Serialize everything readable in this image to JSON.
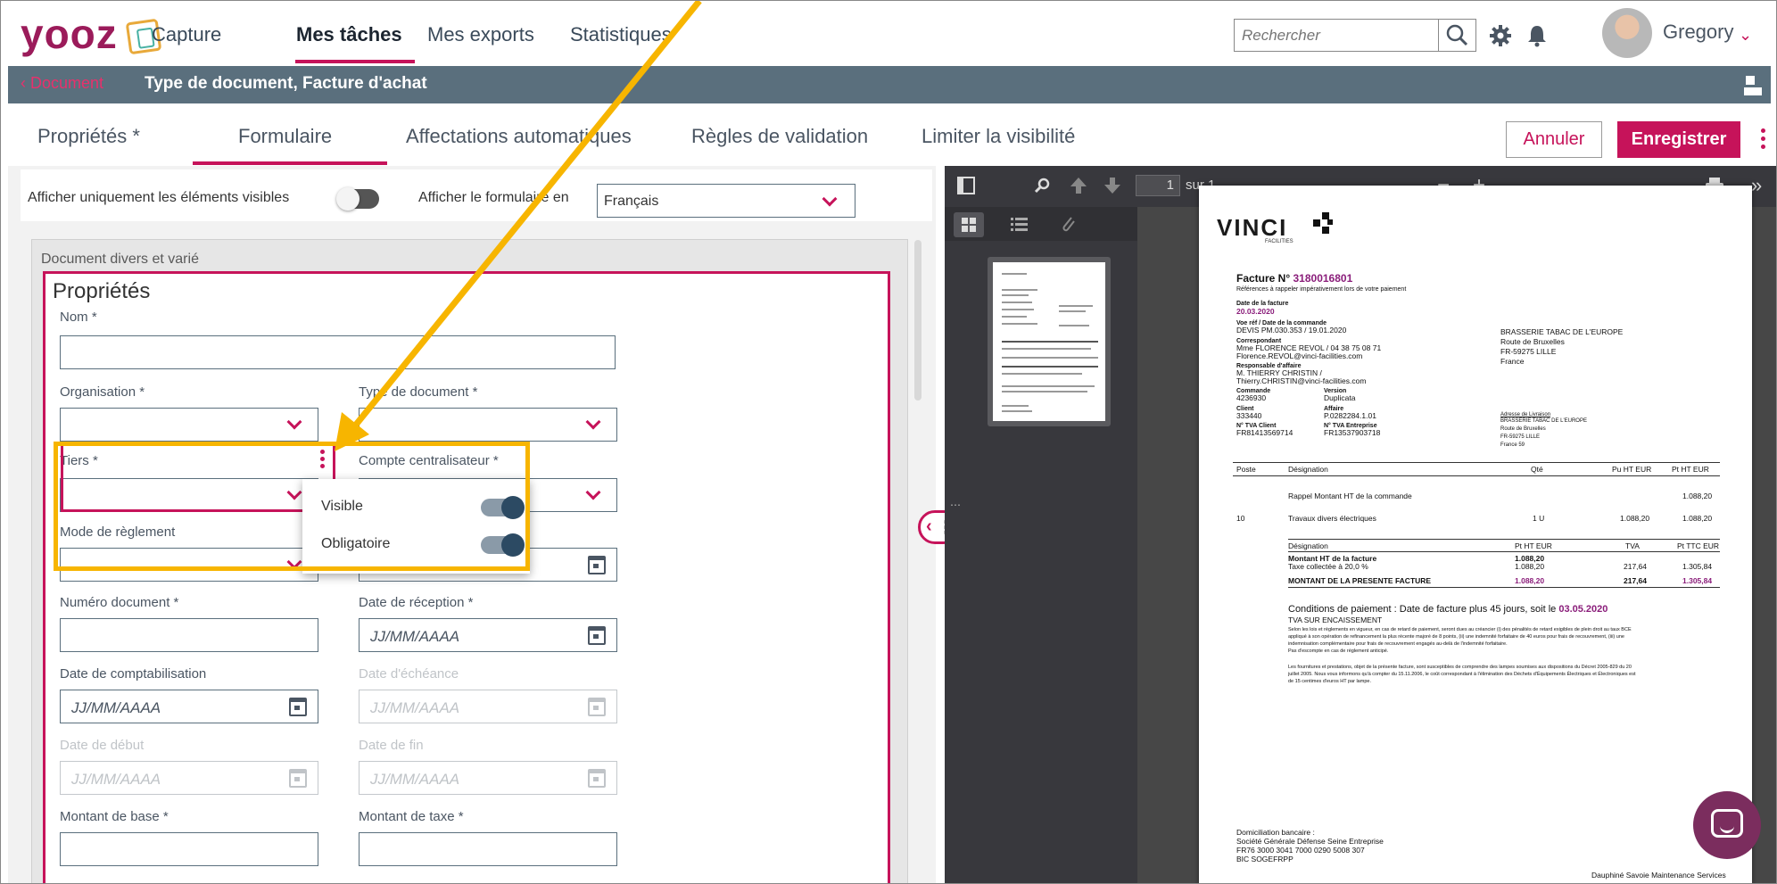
{
  "topnav": {
    "logo": "yooz",
    "links": [
      "Capture",
      "Mes tâches",
      "Mes exports",
      "Statistiques"
    ],
    "search_placeholder": "Rechercher",
    "user": "Gregory"
  },
  "breadcrumb": {
    "back": "Document",
    "title": "Type de document, Facture d'achat"
  },
  "subtabs": [
    "Propriétés *",
    "Formulaire",
    "Affectations automatiques",
    "Règles de validation",
    "Limiter la visibilité"
  ],
  "actions": {
    "cancel": "Annuler",
    "save": "Enregistrer"
  },
  "options": {
    "visible_only": "Afficher uniquement les éléments visibles",
    "show_form_in": "Afficher le formulaire en",
    "language": "Français"
  },
  "form": {
    "section": "Document divers et varié",
    "title": "Propriétés",
    "date_placeholder": "JJ/MM/AAAA",
    "fields": {
      "nom": "Nom *",
      "organisation": "Organisation *",
      "type_document": "Type de document *",
      "tiers": "Tiers *",
      "compte": "Compte centralisateur *",
      "mode_reglement": "Mode de règlement",
      "numero": "Numéro document *",
      "date_reception": "Date de réception *",
      "date_compta": "Date de comptabilisation",
      "date_echeance": "Date d'échéance",
      "date_debut": "Date de début",
      "date_fin": "Date de fin",
      "montant_base": "Montant de base *",
      "montant_taxe": "Montant de taxe *"
    }
  },
  "context_menu": {
    "visible": "Visible",
    "obligatoire": "Obligatoire"
  },
  "viewer": {
    "page": "1",
    "page_of": "sur 1",
    "pdf": {
      "logo": "VINCI",
      "logo_sub": "FACILITIES",
      "invoice_label": "Facture N°",
      "invoice_no": "3180016801",
      "ref_note": "Références à rappeler impérativement lors de votre paiement",
      "date_label": "Date de la facture",
      "date": "20.03.2020",
      "order_label": "Voe réf / Date de la commande",
      "order": "DEVIS PM.030.353 / 19.01.2020",
      "corr_label": "Correspondant",
      "corr1": "Mme FLORENCE REVOL / 04 38 75 08 71",
      "corr2": "Florence.REVOL@vinci-facilities.com",
      "resp_label": "Responsable d'affaire",
      "resp1": "M. THIERRY CHRISTIN /",
      "resp2": "Thierry.CHRISTIN@vinci-facilities.com",
      "cmd_label": "Commande",
      "cmd": "4236930",
      "version_label": "Version",
      "version": "Duplicata",
      "client_label": "Client",
      "client": "333440",
      "affaire_label": "Affaire",
      "affaire": "P.0282284.1.01",
      "tva_client_label": "N° TVA Client",
      "tva_client": "FR81413569714",
      "tva_ent_label": "N° TVA Entreprise",
      "tva_ent": "FR13537903718",
      "addr1": "BRASSERIE TABAC DE L'EUROPE",
      "addr2": "Route de Bruxelles",
      "addr3": "FR-59275 LILLE",
      "addr4": "France",
      "deliv_label": "Adresse de Livraison",
      "deliv1": "BRASSERIE TABAC DE L'EUROPE",
      "deliv2": "Route de Bruxelles",
      "deliv3": "FR-59275 LILLE",
      "deliv4": "France 59",
      "col_poste": "Poste",
      "col_designation": "Désignation",
      "col_qte": "Qté",
      "col_pu": "Pu HT EUR",
      "col_pt": "Pt HT EUR",
      "row_rappel": "Rappel Montant HT de la commande",
      "row_rappel_val": "1.088,20",
      "row_poste": "10",
      "row_travaux": "Travaux divers électriques",
      "row_qte": "1 U",
      "row_pu": "1.088,20",
      "row_pt": "1.088,20",
      "tot_col_des": "Désignation",
      "tot_col_ht": "Pt HT EUR",
      "tot_col_tva": "TVA",
      "tot_col_ttc": "Pt TTC EUR",
      "tot_ht_label": "Montant HT de la facture",
      "tot_ht": "1.088,20",
      "tot_tax_label": "Taxe collectée à 20,0 %",
      "tot_tax_base": "1.088,20",
      "tot_tax_tva": "217,64",
      "tot_tax_ttc": "1.305,84",
      "tot_final_label": "MONTANT DE LA PRESENTE FACTURE",
      "tot_final_ht": "1.088,20",
      "tot_final_tva": "217,64",
      "tot_final_ttc": "1.305,84",
      "cond_label": "Conditions de paiement :",
      "cond_text": "Date de facture plus 45 jours,",
      "cond_due": "soit le",
      "cond_date": "03.05.2020",
      "tva_enc": "TVA SUR ENCAISSEMENT",
      "legal1": "Selon les lois et règlements en vigueur, en cas de retard de paiement, seront dues au créancier (i) des pénalités de retard exigibles de plein droit au taux BCE",
      "legal2": "appliqué à son opération de refinancement la plus récente majoré de 8 points, (ii) une indemnité forfaitaire de 40 euros pour frais de recouvrement, (iii) une",
      "legal3": "indemnisation complémentaire pour frais de recouvrement engagés au-delà de l'indemnité forfaitaire.",
      "legal4": "Pas d'escompte en cas de règlement anticipé.",
      "legal5": "Les fournitures et prestations, objet de la présente facture, sont susceptibles de comprendre des lampes soumises aux dispositions du Décret 2005-829 du 20",
      "legal6": "juillet 2005. Nous vous informons qu'à compter du 15.11.2006, le coût correspondant à l'élimination des Déchets d'Équipements Électriques et Électroniques est",
      "legal7": "de 15 centimes d'euros HT par lampe.",
      "bank_label": "Domiciliation bancaire :",
      "bank1": "Société Générale Défense Seine Entreprise",
      "bank2": "FR76 3000 3041 7000 0290 5008 307",
      "bank3": "BIC SOGEFRPP",
      "footer": "Dauphiné Savoie Maintenance Services"
    }
  },
  "colors": {
    "accent": "#c6135a",
    "nav_bar": "#5a6f7d",
    "annotation": "#f7b500"
  }
}
